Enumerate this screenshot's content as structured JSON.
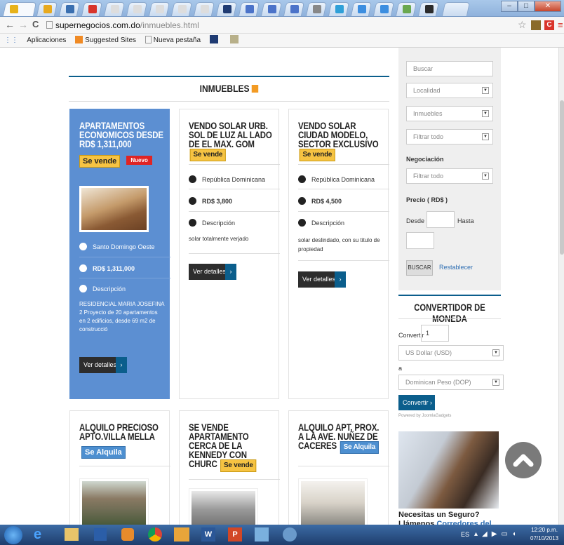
{
  "browser": {
    "url_domain": "supernegocios.com.do",
    "url_path": "/inmuebles.html",
    "bookmarks": [
      "Aplicaciones",
      "Suggested Sites",
      "Nueva pestaña"
    ],
    "tab_label": "S"
  },
  "section": {
    "title": "INMUEBLES"
  },
  "listings": [
    {
      "title": "APARTAMENTOS ECONOMICOS DESDE RD$ 1,311,000",
      "badge": "Se vende",
      "new_badge": "Nuevo",
      "location": "Santo Domingo Oeste",
      "price": "RD$ 1,311,000",
      "desc_label": "Descripción",
      "desc_lines": [
        "RESIDENCIAL MARIA JOSEFINA",
        "2 Proyecto de 20 apartamentos",
        "en 2 edificios, desde 69 m2 de",
        "construcció"
      ],
      "button": "Ver detalles"
    },
    {
      "title": "VENDO SOLAR URB. SOL DE LUZ AL LADO DE EL MAX. GOM",
      "badge": "Se vende",
      "location": "República Dominicana",
      "price": "RD$ 3,800",
      "desc_label": "Descripción",
      "desc_lines": [
        "solar totalmente verjado"
      ],
      "button": "Ver detalles"
    },
    {
      "title": "VENDO SOLAR CIUDAD MODELO, SECTOR EXCLUSIVO",
      "badge": "Se vende",
      "location": "República Dominicana",
      "price": "RD$ 4,500",
      "desc_label": "Descripción",
      "desc_lines": [
        "solar deslindado, con su titulo de",
        "propiedad"
      ],
      "button": "Ver detalles"
    },
    {
      "title": "ALQUILO PRECIOSO APTO.VILLA MELLA",
      "badge": "Se Alquila"
    },
    {
      "title": "SE VENDE APARTAMENTO CERCA DE LA KENNEDY CON CHURC",
      "badge": "Se vende"
    },
    {
      "title": "ALQUILO APT. PROX. A LA AVE. NUÑEZ DE CACERES",
      "badge": "Se Alquila"
    }
  ],
  "search": {
    "buscar_placeholder": "Buscar",
    "localidad": "Localidad",
    "inmuebles": "Inmuebles",
    "filtrar1": "Filtrar todo",
    "negociacion_label": "Negociación",
    "filtrar2": "Filtrar todo",
    "precio_label": "Precio ( RD$ )",
    "desde": "Desde",
    "hasta": "Hasta",
    "buscar_btn": "BUSCAR",
    "reset": "Restablecer"
  },
  "converter": {
    "title": "CONVERTIDOR DE MONEDA",
    "convertir_label": "Convertir",
    "amount": "1",
    "from": "US Dollar (USD)",
    "a": "a",
    "to": "Dominican Peso (DOP)",
    "button": "Convertir",
    "powered": "Powered by JoomlaGadgets"
  },
  "ad": {
    "line1": "Necesitas un Seguro?",
    "line2_a": "Llámenos",
    "line2_b": "Corredores del"
  },
  "taskbar": {
    "lang": "ES",
    "time": "12:20 p.m.",
    "date": "07/10/2013"
  }
}
